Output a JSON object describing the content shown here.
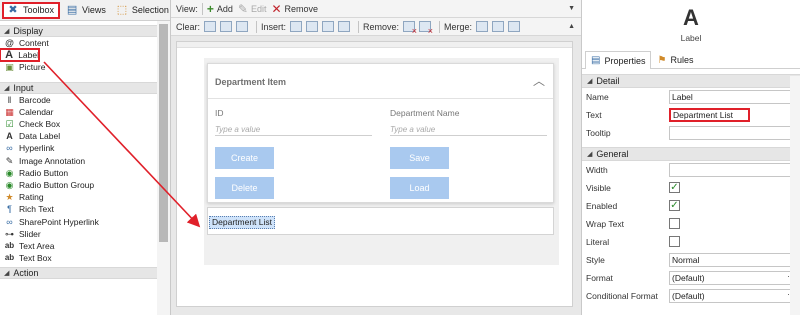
{
  "left_tabs": [
    {
      "label": "Toolbox",
      "icon": "toolbox-icon",
      "active": true
    },
    {
      "label": "Views",
      "icon": "views-icon"
    },
    {
      "label": "Selection",
      "icon": "selection-icon"
    }
  ],
  "sections": {
    "display": "Display",
    "input": "Input",
    "action": "Action"
  },
  "display_items": [
    {
      "label": "Content",
      "icon": "at-icon",
      "glyph": "@"
    },
    {
      "label": "Label",
      "icon": "label-a-icon",
      "glyph": "A"
    },
    {
      "label": "Picture",
      "icon": "picture-icon",
      "glyph": "▣"
    }
  ],
  "input_items": [
    {
      "label": "Barcode",
      "icon": "barcode-icon",
      "glyph": "‖"
    },
    {
      "label": "Calendar",
      "icon": "calendar-icon",
      "glyph": "▦"
    },
    {
      "label": "Check Box",
      "icon": "checkbox-icon",
      "glyph": "☑"
    },
    {
      "label": "Data Label",
      "icon": "data-label-icon",
      "glyph": "A"
    },
    {
      "label": "Hyperlink",
      "icon": "hyperlink-icon",
      "glyph": "∞"
    },
    {
      "label": "Image Annotation",
      "icon": "image-annotation-icon",
      "glyph": "✎"
    },
    {
      "label": "Radio Button",
      "icon": "radio-icon",
      "glyph": "◉"
    },
    {
      "label": "Radio Button Group",
      "icon": "radio-group-icon",
      "glyph": "◉"
    },
    {
      "label": "Rating",
      "icon": "star-icon",
      "glyph": "★"
    },
    {
      "label": "Rich Text",
      "icon": "rich-text-icon",
      "glyph": "¶"
    },
    {
      "label": "SharePoint Hyperlink",
      "icon": "sharepoint-link-icon",
      "glyph": "∞"
    },
    {
      "label": "Slider",
      "icon": "slider-icon",
      "glyph": "⊶"
    },
    {
      "label": "Text Area",
      "icon": "text-area-icon",
      "glyph": "ab"
    },
    {
      "label": "Text Box",
      "icon": "text-box-icon",
      "glyph": "ab"
    }
  ],
  "toolbar": {
    "view_label": "View:",
    "add_label": "Add",
    "edit_label": "Edit",
    "remove_label": "Remove",
    "clear_label": "Clear:",
    "insert_label": "Insert:",
    "remove2_label": "Remove:",
    "merge_label": "Merge:"
  },
  "form": {
    "card_title": "Department Item",
    "id_label": "ID",
    "id_placeholder": "Type a value",
    "name_label": "Department Name",
    "name_placeholder": "Type a value",
    "create_label": "Create",
    "save_label": "Save",
    "delete_label": "Delete",
    "load_label": "Load",
    "label_text": "Department List"
  },
  "properties": {
    "control_glyph": "A",
    "control_name": "Label",
    "tabs": [
      "Properties",
      "Rules"
    ],
    "detail_heading": "Detail",
    "name_label": "Name",
    "name_value": "Label",
    "text_label": "Text",
    "text_value": "Department List",
    "tooltip_label": "Tooltip",
    "tooltip_value": "",
    "general_heading": "General",
    "width_label": "Width",
    "visible_label": "Visible",
    "enabled_label": "Enabled",
    "wrap_label": "Wrap Text",
    "literal_label": "Literal",
    "style_label": "Style",
    "style_value": "Normal",
    "format_label": "Format",
    "format_value": "(Default)",
    "cond_format_label": "Conditional Format",
    "cond_format_value": "(Default)"
  },
  "checks": {
    "visible": true,
    "enabled": true,
    "wrap": false,
    "literal": false
  },
  "colors": {
    "highlight": "#e0202a",
    "button": "#a9c9ef",
    "check": "#2a8a2a"
  }
}
